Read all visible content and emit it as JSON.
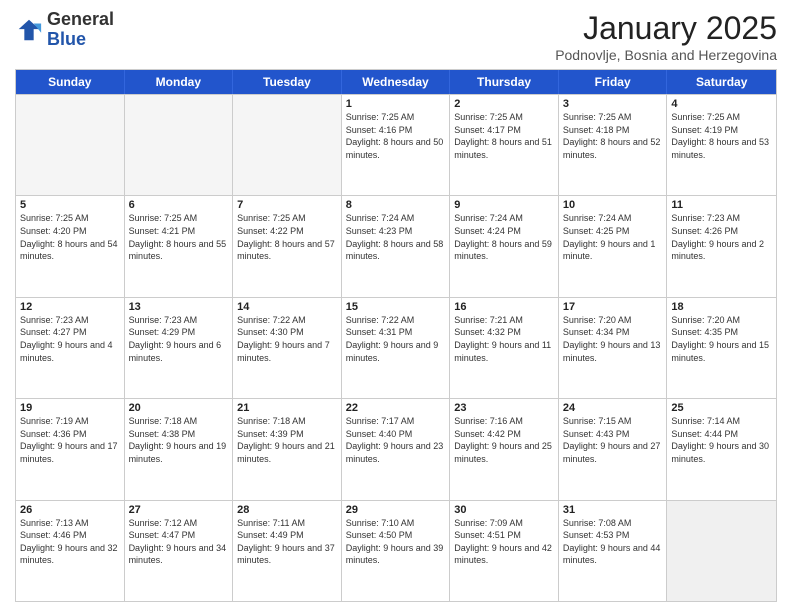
{
  "header": {
    "logo_general": "General",
    "logo_blue": "Blue",
    "month_title": "January 2025",
    "location": "Podnovlje, Bosnia and Herzegovina"
  },
  "days_of_week": [
    "Sunday",
    "Monday",
    "Tuesday",
    "Wednesday",
    "Thursday",
    "Friday",
    "Saturday"
  ],
  "rows": [
    [
      {
        "day": "",
        "info": "",
        "empty": true
      },
      {
        "day": "",
        "info": "",
        "empty": true
      },
      {
        "day": "",
        "info": "",
        "empty": true
      },
      {
        "day": "1",
        "info": "Sunrise: 7:25 AM\nSunset: 4:16 PM\nDaylight: 8 hours\nand 50 minutes."
      },
      {
        "day": "2",
        "info": "Sunrise: 7:25 AM\nSunset: 4:17 PM\nDaylight: 8 hours\nand 51 minutes."
      },
      {
        "day": "3",
        "info": "Sunrise: 7:25 AM\nSunset: 4:18 PM\nDaylight: 8 hours\nand 52 minutes."
      },
      {
        "day": "4",
        "info": "Sunrise: 7:25 AM\nSunset: 4:19 PM\nDaylight: 8 hours\nand 53 minutes."
      }
    ],
    [
      {
        "day": "5",
        "info": "Sunrise: 7:25 AM\nSunset: 4:20 PM\nDaylight: 8 hours\nand 54 minutes."
      },
      {
        "day": "6",
        "info": "Sunrise: 7:25 AM\nSunset: 4:21 PM\nDaylight: 8 hours\nand 55 minutes."
      },
      {
        "day": "7",
        "info": "Sunrise: 7:25 AM\nSunset: 4:22 PM\nDaylight: 8 hours\nand 57 minutes."
      },
      {
        "day": "8",
        "info": "Sunrise: 7:24 AM\nSunset: 4:23 PM\nDaylight: 8 hours\nand 58 minutes."
      },
      {
        "day": "9",
        "info": "Sunrise: 7:24 AM\nSunset: 4:24 PM\nDaylight: 8 hours\nand 59 minutes."
      },
      {
        "day": "10",
        "info": "Sunrise: 7:24 AM\nSunset: 4:25 PM\nDaylight: 9 hours\nand 1 minute."
      },
      {
        "day": "11",
        "info": "Sunrise: 7:23 AM\nSunset: 4:26 PM\nDaylight: 9 hours\nand 2 minutes."
      }
    ],
    [
      {
        "day": "12",
        "info": "Sunrise: 7:23 AM\nSunset: 4:27 PM\nDaylight: 9 hours\nand 4 minutes."
      },
      {
        "day": "13",
        "info": "Sunrise: 7:23 AM\nSunset: 4:29 PM\nDaylight: 9 hours\nand 6 minutes."
      },
      {
        "day": "14",
        "info": "Sunrise: 7:22 AM\nSunset: 4:30 PM\nDaylight: 9 hours\nand 7 minutes."
      },
      {
        "day": "15",
        "info": "Sunrise: 7:22 AM\nSunset: 4:31 PM\nDaylight: 9 hours\nand 9 minutes."
      },
      {
        "day": "16",
        "info": "Sunrise: 7:21 AM\nSunset: 4:32 PM\nDaylight: 9 hours\nand 11 minutes."
      },
      {
        "day": "17",
        "info": "Sunrise: 7:20 AM\nSunset: 4:34 PM\nDaylight: 9 hours\nand 13 minutes."
      },
      {
        "day": "18",
        "info": "Sunrise: 7:20 AM\nSunset: 4:35 PM\nDaylight: 9 hours\nand 15 minutes."
      }
    ],
    [
      {
        "day": "19",
        "info": "Sunrise: 7:19 AM\nSunset: 4:36 PM\nDaylight: 9 hours\nand 17 minutes."
      },
      {
        "day": "20",
        "info": "Sunrise: 7:18 AM\nSunset: 4:38 PM\nDaylight: 9 hours\nand 19 minutes."
      },
      {
        "day": "21",
        "info": "Sunrise: 7:18 AM\nSunset: 4:39 PM\nDaylight: 9 hours\nand 21 minutes."
      },
      {
        "day": "22",
        "info": "Sunrise: 7:17 AM\nSunset: 4:40 PM\nDaylight: 9 hours\nand 23 minutes."
      },
      {
        "day": "23",
        "info": "Sunrise: 7:16 AM\nSunset: 4:42 PM\nDaylight: 9 hours\nand 25 minutes."
      },
      {
        "day": "24",
        "info": "Sunrise: 7:15 AM\nSunset: 4:43 PM\nDaylight: 9 hours\nand 27 minutes."
      },
      {
        "day": "25",
        "info": "Sunrise: 7:14 AM\nSunset: 4:44 PM\nDaylight: 9 hours\nand 30 minutes."
      }
    ],
    [
      {
        "day": "26",
        "info": "Sunrise: 7:13 AM\nSunset: 4:46 PM\nDaylight: 9 hours\nand 32 minutes."
      },
      {
        "day": "27",
        "info": "Sunrise: 7:12 AM\nSunset: 4:47 PM\nDaylight: 9 hours\nand 34 minutes."
      },
      {
        "day": "28",
        "info": "Sunrise: 7:11 AM\nSunset: 4:49 PM\nDaylight: 9 hours\nand 37 minutes."
      },
      {
        "day": "29",
        "info": "Sunrise: 7:10 AM\nSunset: 4:50 PM\nDaylight: 9 hours\nand 39 minutes."
      },
      {
        "day": "30",
        "info": "Sunrise: 7:09 AM\nSunset: 4:51 PM\nDaylight: 9 hours\nand 42 minutes."
      },
      {
        "day": "31",
        "info": "Sunrise: 7:08 AM\nSunset: 4:53 PM\nDaylight: 9 hours\nand 44 minutes."
      },
      {
        "day": "",
        "info": "",
        "empty": true,
        "shaded": true
      }
    ]
  ]
}
